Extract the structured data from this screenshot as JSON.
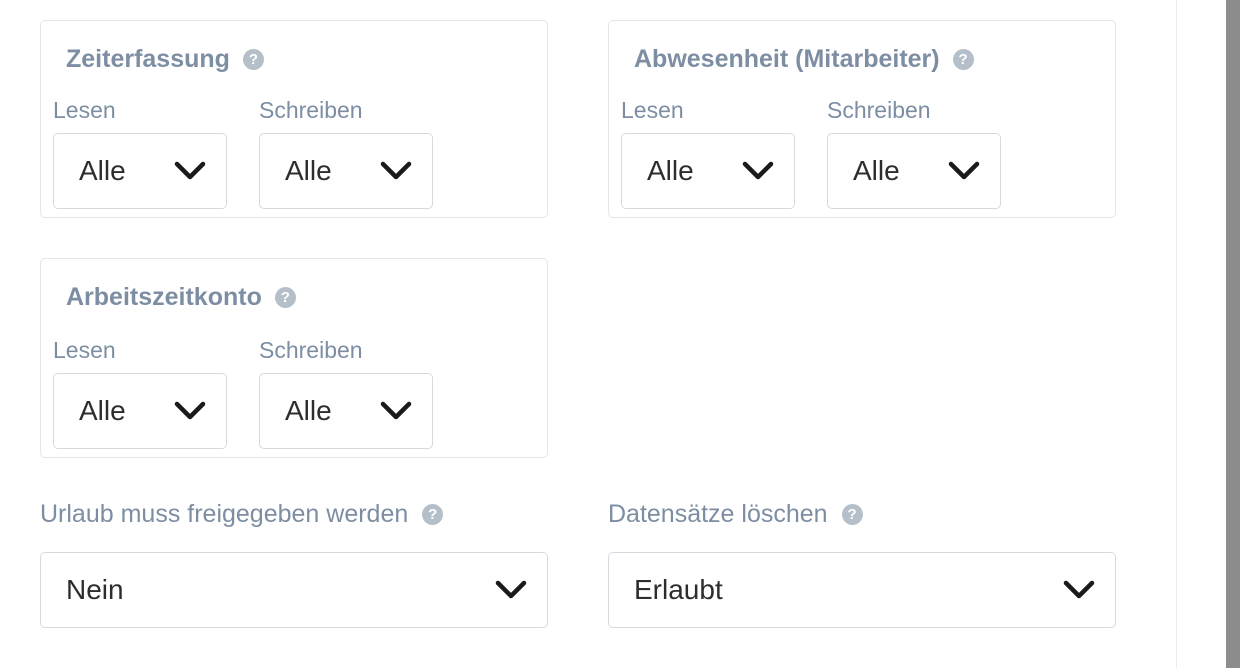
{
  "groups": [
    {
      "title": "Zeiterfassung",
      "read_label": "Lesen",
      "write_label": "Schreiben",
      "read_value": "Alle",
      "write_value": "Alle"
    },
    {
      "title": "Abwesenheit (Mitarbeiter)",
      "read_label": "Lesen",
      "write_label": "Schreiben",
      "read_value": "Alle",
      "write_value": "Alle"
    },
    {
      "title": "Arbeitszeitkonto",
      "read_label": "Lesen",
      "write_label": "Schreiben",
      "read_value": "Alle",
      "write_value": "Alle"
    }
  ],
  "vacation": {
    "label": "Urlaub muss freigegeben werden",
    "value": "Nein"
  },
  "delete_records": {
    "label": "Datensätze löschen",
    "value": "Erlaubt"
  },
  "icons": {
    "help": "question-circle-icon",
    "chevron": "chevron-down-icon"
  },
  "colors": {
    "label": "#7d8ea3",
    "border": "#d5dae0",
    "help_icon": "#b5bfca"
  }
}
